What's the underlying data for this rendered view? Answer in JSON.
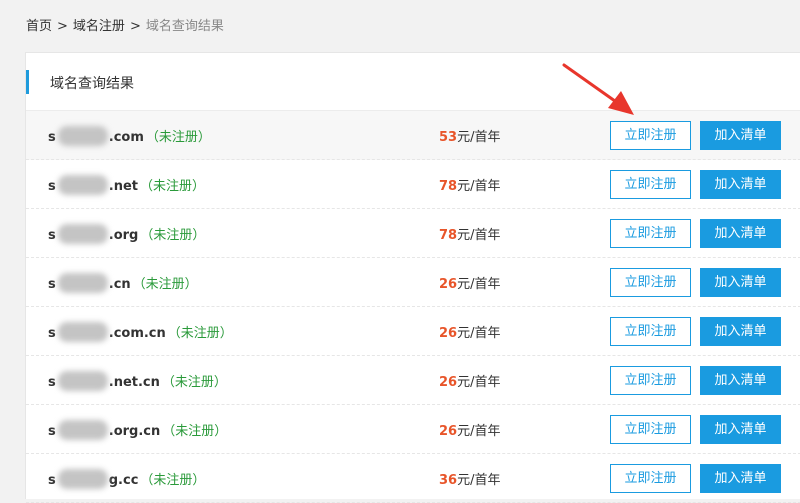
{
  "breadcrumb": {
    "home": "首页",
    "separator": ">",
    "register": "域名注册",
    "current": "域名查询结果"
  },
  "panel": {
    "title": "域名查询结果"
  },
  "results": [
    {
      "prefix": "s",
      "suffix": ".com",
      "status": "（未注册）",
      "price": "53",
      "unit": "元/首年",
      "register_label": "立即注册",
      "add_label": "加入清单"
    },
    {
      "prefix": "s",
      "suffix": ".net",
      "status": "（未注册）",
      "price": "78",
      "unit": "元/首年",
      "register_label": "立即注册",
      "add_label": "加入清单"
    },
    {
      "prefix": "s",
      "suffix": ".org",
      "status": "（未注册）",
      "price": "78",
      "unit": "元/首年",
      "register_label": "立即注册",
      "add_label": "加入清单"
    },
    {
      "prefix": "s",
      "suffix": ".cn",
      "status": "（未注册）",
      "price": "26",
      "unit": "元/首年",
      "register_label": "立即注册",
      "add_label": "加入清单"
    },
    {
      "prefix": "s",
      "suffix": ".com.cn",
      "status": "（未注册）",
      "price": "26",
      "unit": "元/首年",
      "register_label": "立即注册",
      "add_label": "加入清单"
    },
    {
      "prefix": "s",
      "suffix": ".net.cn",
      "status": "（未注册）",
      "price": "26",
      "unit": "元/首年",
      "register_label": "立即注册",
      "add_label": "加入清单"
    },
    {
      "prefix": "s",
      "suffix": ".org.cn",
      "status": "（未注册）",
      "price": "26",
      "unit": "元/首年",
      "register_label": "立即注册",
      "add_label": "加入清单"
    },
    {
      "prefix": "s",
      "suffix": "g.cc",
      "status": "（未注册）",
      "price": "36",
      "unit": "元/首年",
      "register_label": "立即注册",
      "add_label": "加入清单"
    }
  ],
  "colors": {
    "accent": "#1a9be0",
    "price": "#e8552a",
    "status": "#2a9a3a",
    "annotation_arrow": "#e8362c"
  }
}
